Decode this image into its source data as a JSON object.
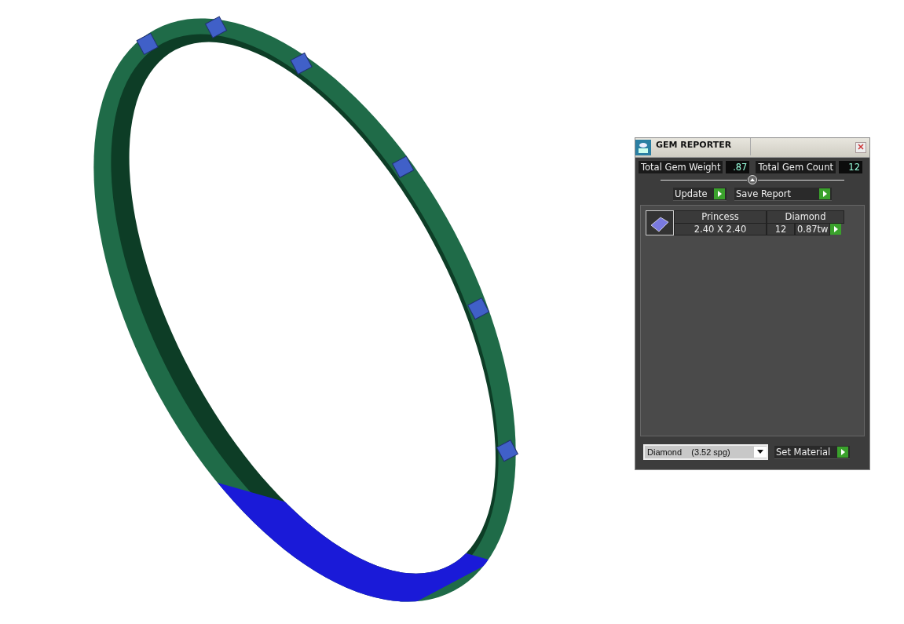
{
  "panel": {
    "title": "GEM REPORTER",
    "totals": [
      {
        "label": "Total Gem Weight",
        "value": ".87"
      },
      {
        "label": "Total Gem Count",
        "value": "12"
      }
    ],
    "buttons": [
      "Update",
      "Save Report"
    ],
    "gems": [
      {
        "shape": "Princess",
        "material": "Diamond",
        "size": "2.40 X 2.40",
        "count": "12",
        "weight": "0.87tw"
      }
    ],
    "material_select": {
      "value": "Diamond    (3.52 spg)"
    },
    "set_button": "Set Material"
  }
}
